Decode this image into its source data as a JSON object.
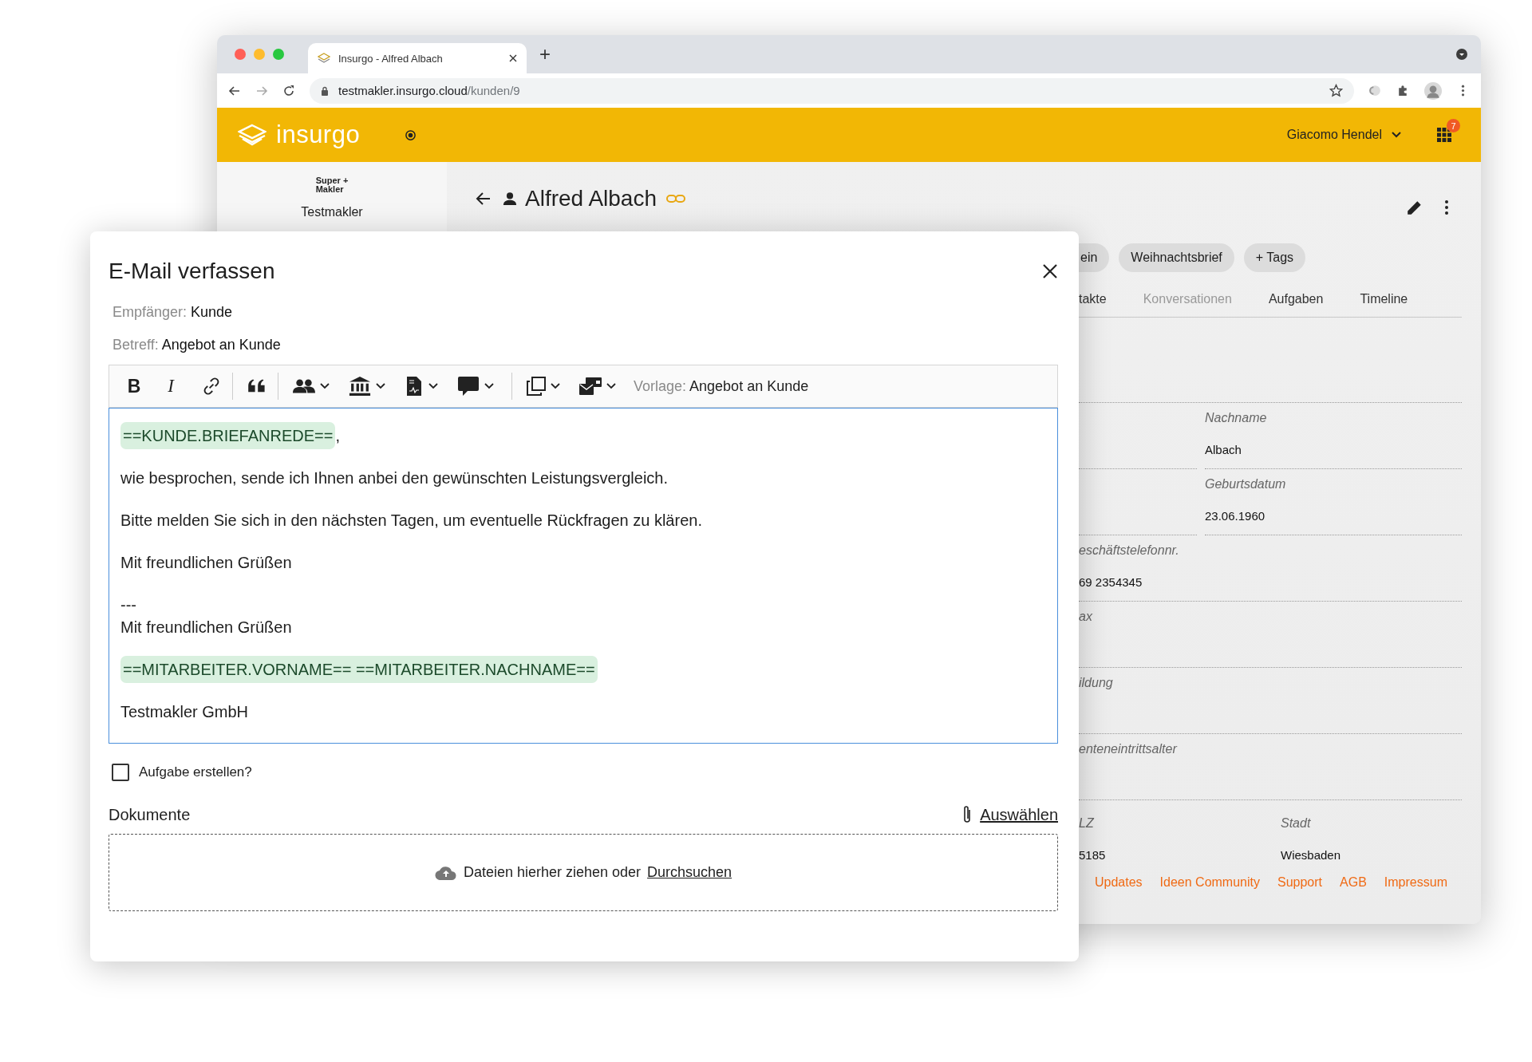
{
  "browser": {
    "tab_title": "Insurgo - Alfred Albach",
    "new_tab": "+",
    "url_host": "testmakler.insurgo.cloud",
    "url_path": "/kunden/9"
  },
  "app_header": {
    "logo": "insurgo",
    "user": "Giacomo Hendel",
    "notification_count": "7"
  },
  "sidebar": {
    "brand_lines": [
      "Super +",
      "Makler"
    ],
    "company": "Testmakler"
  },
  "customer": {
    "name": "Alfred Albach"
  },
  "tags": [
    "ein",
    "Weihnachtsbrief",
    "+ Tags"
  ],
  "tabs": [
    {
      "label": "takte",
      "disabled": false
    },
    {
      "label": "Konversationen",
      "disabled": true
    },
    {
      "label": "Aufgaben",
      "disabled": false
    },
    {
      "label": "Timeline",
      "disabled": false
    }
  ],
  "field_rows": [
    {
      "kind": "split",
      "cells": [
        {},
        {
          "label": "Nachname",
          "value": "Albach"
        }
      ]
    },
    {
      "kind": "split",
      "cells": [
        {},
        {
          "label": "Geburtsdatum",
          "value": "23.06.1960"
        }
      ]
    },
    {
      "kind": "wide",
      "cells": [
        {
          "label": "eschäftstelefonnr.",
          "value": "69 2354345"
        }
      ]
    },
    {
      "kind": "wide",
      "cells": [
        {
          "label": "ax"
        }
      ]
    },
    {
      "kind": "wide",
      "cells": [
        {
          "label": "ildung"
        }
      ]
    },
    {
      "kind": "wide",
      "cells": [
        {
          "label": "enteneintrittsalter"
        }
      ]
    },
    {
      "kind": "address",
      "cells": [
        {
          "label": "LZ",
          "value": "5185"
        },
        {
          "label": "Stadt",
          "value": "Wiesbaden"
        }
      ]
    }
  ],
  "footer_links": [
    "Updates",
    "Ideen Community",
    "Support",
    "AGB",
    "Impressum"
  ],
  "dialog": {
    "title": "E-Mail verfassen",
    "recipient": {
      "label": "Empfänger:",
      "value": "Kunde"
    },
    "subject": {
      "label": "Betreff:",
      "value": "Angebot an Kunde"
    },
    "toolbar": {
      "format": [
        "B",
        "I"
      ],
      "template_label": "Vorlage:",
      "template_value": "Angebot an Kunde"
    },
    "body": [
      [
        [
          {
            "kind": "token",
            "text": "==KUNDE.BRIEFANREDE=="
          },
          {
            "kind": "text",
            "text": ","
          }
        ]
      ],
      [
        [
          {
            "kind": "text",
            "text": "wie besprochen, sende ich Ihnen anbei den gewünschten Leistungsvergleich."
          }
        ]
      ],
      [
        [
          {
            "kind": "text",
            "text": "Bitte melden Sie sich in den nächsten Tagen, um eventuelle Rückfragen zu klären."
          }
        ]
      ],
      [
        [
          {
            "kind": "text",
            "text": "Mit freundlichen Grüßen"
          }
        ]
      ],
      [
        [
          {
            "kind": "text",
            "text": "---"
          }
        ],
        [
          {
            "kind": "text",
            "text": "Mit freundlichen Grüßen"
          }
        ]
      ],
      [
        [
          {
            "kind": "token",
            "text": "==MITARBEITER.VORNAME== ==MITARBEITER.NACHNAME=="
          }
        ]
      ],
      [
        [
          {
            "kind": "text",
            "text": "Testmakler GmbH"
          }
        ]
      ]
    ],
    "task_checkbox": {
      "label": "Aufgabe erstellen?",
      "checked": false
    },
    "documents": {
      "title": "Dokumente",
      "select_link": "Auswählen",
      "drop_text": "Dateien hierher ziehen oder",
      "browse_link": "Durchsuchen"
    }
  }
}
